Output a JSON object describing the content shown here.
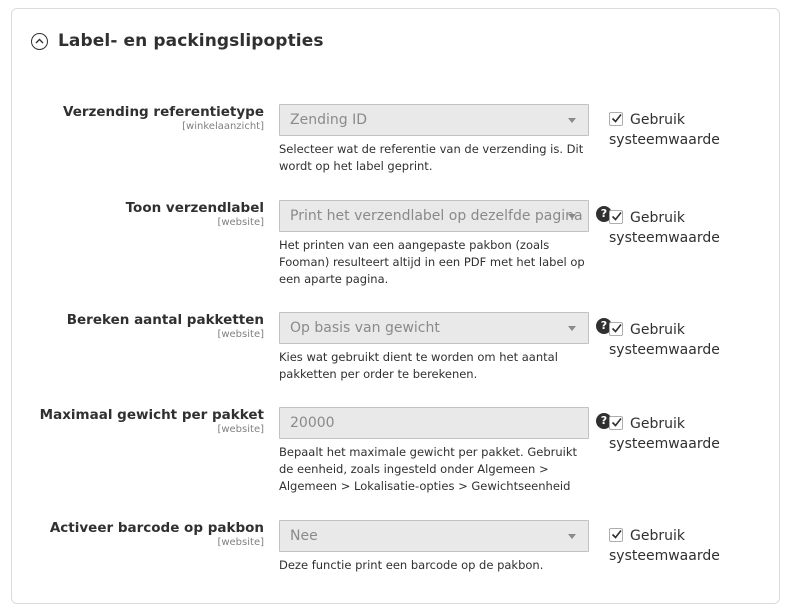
{
  "section": {
    "title": "Label- en packingslipopties",
    "icon": "collapse-circle-icon"
  },
  "use_default": {
    "line1": "Gebruik",
    "line2": "systeemwaarde"
  },
  "fields": [
    {
      "label": "Verzending referentietype",
      "scope": "[winkelaanzicht]",
      "value": "Zending ID",
      "note": "Selecteer wat de referentie van de verzending is. Dit wordt op het label geprint.",
      "use_default_checked": true
    },
    {
      "label": "Toon verzendlabel",
      "scope": "[website]",
      "value": "Print het verzendlabel op dezelfde pagina",
      "note": "Het printen van een aangepaste pakbon (zoals Fooman) resulteert altijd in een PDF met het label op een aparte pagina.",
      "help": "?",
      "use_default_checked": true
    },
    {
      "label": "Bereken aantal pakketten",
      "scope": "[website]",
      "value": "Op basis van gewicht",
      "note": "Kies wat gebruikt dient te worden om het aantal pakketten per order te berekenen.",
      "help": "?",
      "use_default_checked": true
    },
    {
      "label": "Maximaal gewicht per pakket",
      "scope": "[website]",
      "value": "20000",
      "note": "Bepaalt het maximale gewicht per pakket. Gebruikt de eenheid, zoals ingesteld onder Algemeen > Algemeen > Lokalisatie-opties > Gewichtseenheid",
      "help": "?",
      "use_default_checked": true
    },
    {
      "label": "Activeer barcode op pakbon",
      "scope": "[website]",
      "value": "Nee",
      "note": "Deze functie print een barcode op de pakbon.",
      "use_default_checked": true
    }
  ]
}
